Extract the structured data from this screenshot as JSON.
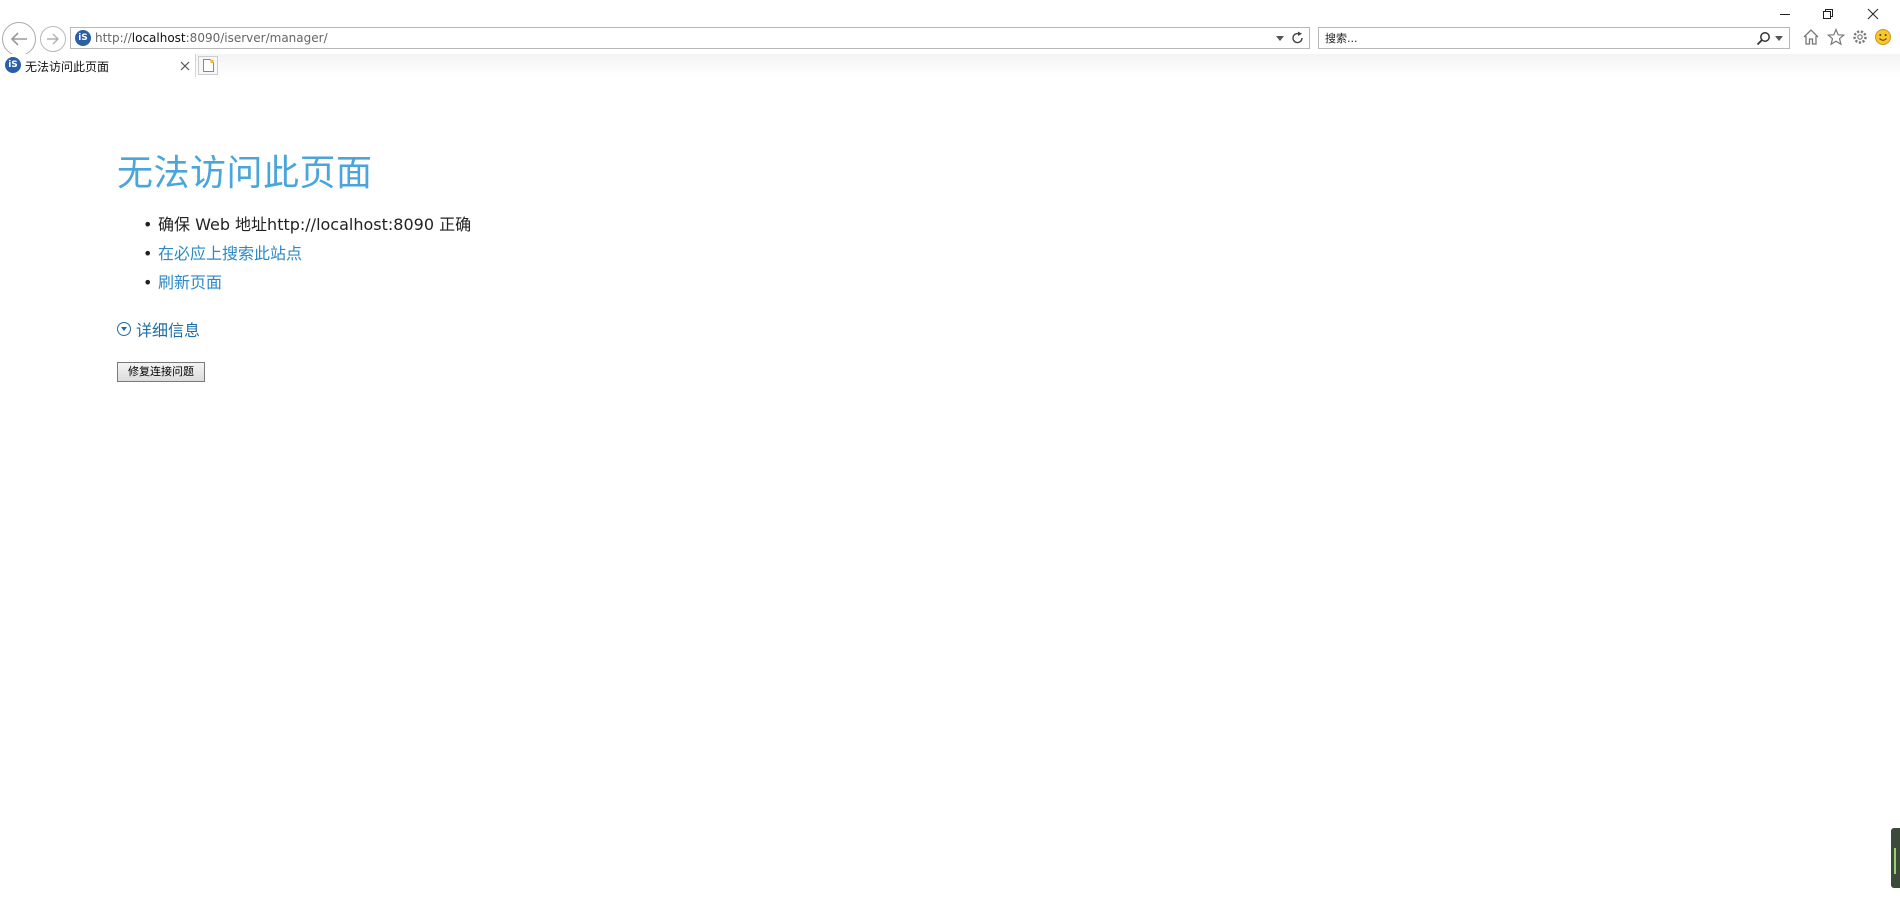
{
  "browser": {
    "url_prefix": "http://",
    "url_host": "localhost",
    "url_rest": ":8090/iserver/manager/",
    "search_placeholder": "搜索...",
    "tab_title": "无法访问此页面",
    "icons": [
      "back-icon",
      "forward-icon",
      "site-icon",
      "dropdown-icon",
      "refresh-icon",
      "search-icon",
      "home-icon",
      "favorites-star-icon",
      "settings-gear-icon",
      "feedback-smiley-icon",
      "minimize-icon",
      "restore-icon",
      "close-icon",
      "tab-close-icon",
      "new-tab-icon"
    ]
  },
  "page": {
    "heading": "无法访问此页面",
    "tip1": "确保 Web 地址http://localhost:8090 正确",
    "tip2": "在必应上搜索此站点",
    "tip3": "刷新页面",
    "details": "详细信息",
    "fix_button": "修复连接问题"
  },
  "colors": {
    "heading": "#4aa6da",
    "link": "#2c89c7",
    "details": "#1d6ea8"
  }
}
